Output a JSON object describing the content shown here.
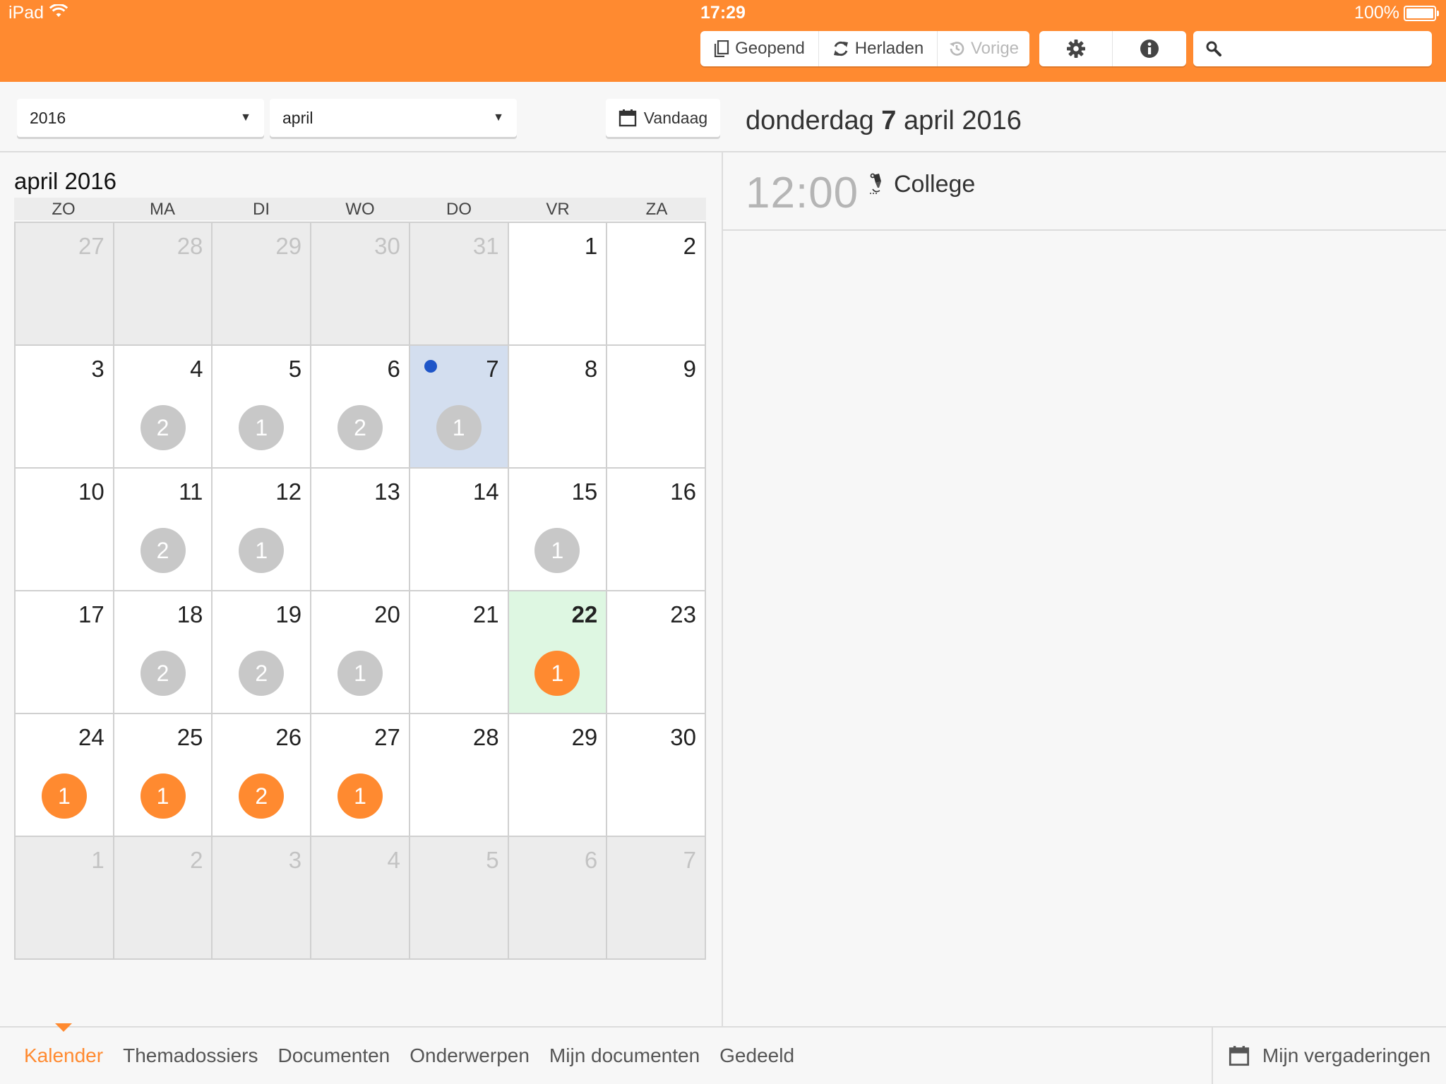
{
  "status_bar": {
    "device": "iPad",
    "time": "17:29",
    "battery": "100%"
  },
  "toolbar": {
    "opened_label": "Geopend",
    "reload_label": "Herladen",
    "previous_label": "Vorige",
    "search_placeholder": ""
  },
  "selectors": {
    "year": "2016",
    "month": "april",
    "today_label": "Vandaag"
  },
  "day_header": {
    "weekday": "donderdag",
    "day": "7",
    "month_year": "april 2016"
  },
  "calendar": {
    "title": "april 2016",
    "weekdays": [
      "ZO",
      "MA",
      "DI",
      "WO",
      "DO",
      "VR",
      "ZA"
    ],
    "days": [
      {
        "n": "27",
        "other": true
      },
      {
        "n": "28",
        "other": true
      },
      {
        "n": "29",
        "other": true
      },
      {
        "n": "30",
        "other": true
      },
      {
        "n": "31",
        "other": true
      },
      {
        "n": "1"
      },
      {
        "n": "2"
      },
      {
        "n": "3"
      },
      {
        "n": "4",
        "count": "2"
      },
      {
        "n": "5",
        "count": "1"
      },
      {
        "n": "6",
        "count": "2"
      },
      {
        "n": "7",
        "count": "1",
        "today": true
      },
      {
        "n": "8"
      },
      {
        "n": "9"
      },
      {
        "n": "10"
      },
      {
        "n": "11",
        "count": "2"
      },
      {
        "n": "12",
        "count": "1"
      },
      {
        "n": "13"
      },
      {
        "n": "14"
      },
      {
        "n": "15",
        "count": "1"
      },
      {
        "n": "16"
      },
      {
        "n": "17"
      },
      {
        "n": "18",
        "count": "2"
      },
      {
        "n": "19",
        "count": "2"
      },
      {
        "n": "20",
        "count": "1"
      },
      {
        "n": "21"
      },
      {
        "n": "22",
        "count": "1",
        "upcoming": true,
        "selected": true
      },
      {
        "n": "23"
      },
      {
        "n": "24",
        "count": "1",
        "upcoming": true
      },
      {
        "n": "25",
        "count": "1",
        "upcoming": true
      },
      {
        "n": "26",
        "count": "2",
        "upcoming": true
      },
      {
        "n": "27",
        "count": "1",
        "upcoming": true
      },
      {
        "n": "28"
      },
      {
        "n": "29"
      },
      {
        "n": "30"
      },
      {
        "n": "1",
        "other": true
      },
      {
        "n": "2",
        "other": true
      },
      {
        "n": "3",
        "other": true
      },
      {
        "n": "4",
        "other": true
      },
      {
        "n": "5",
        "other": true
      },
      {
        "n": "6",
        "other": true
      },
      {
        "n": "7",
        "other": true
      }
    ]
  },
  "event": {
    "time": "12:00",
    "title": "College"
  },
  "tabs": [
    "Kalender",
    "Themadossiers",
    "Documenten",
    "Onderwerpen",
    "Mijn documenten",
    "Gedeeld"
  ],
  "meetings_label": "Mijn vergaderingen",
  "colors": {
    "accent": "#ff8a30",
    "today_bg": "#d3deef",
    "selected_bg": "#def7e2",
    "badge_past": "#c8c8c8",
    "today_dot": "#1e55c8"
  }
}
